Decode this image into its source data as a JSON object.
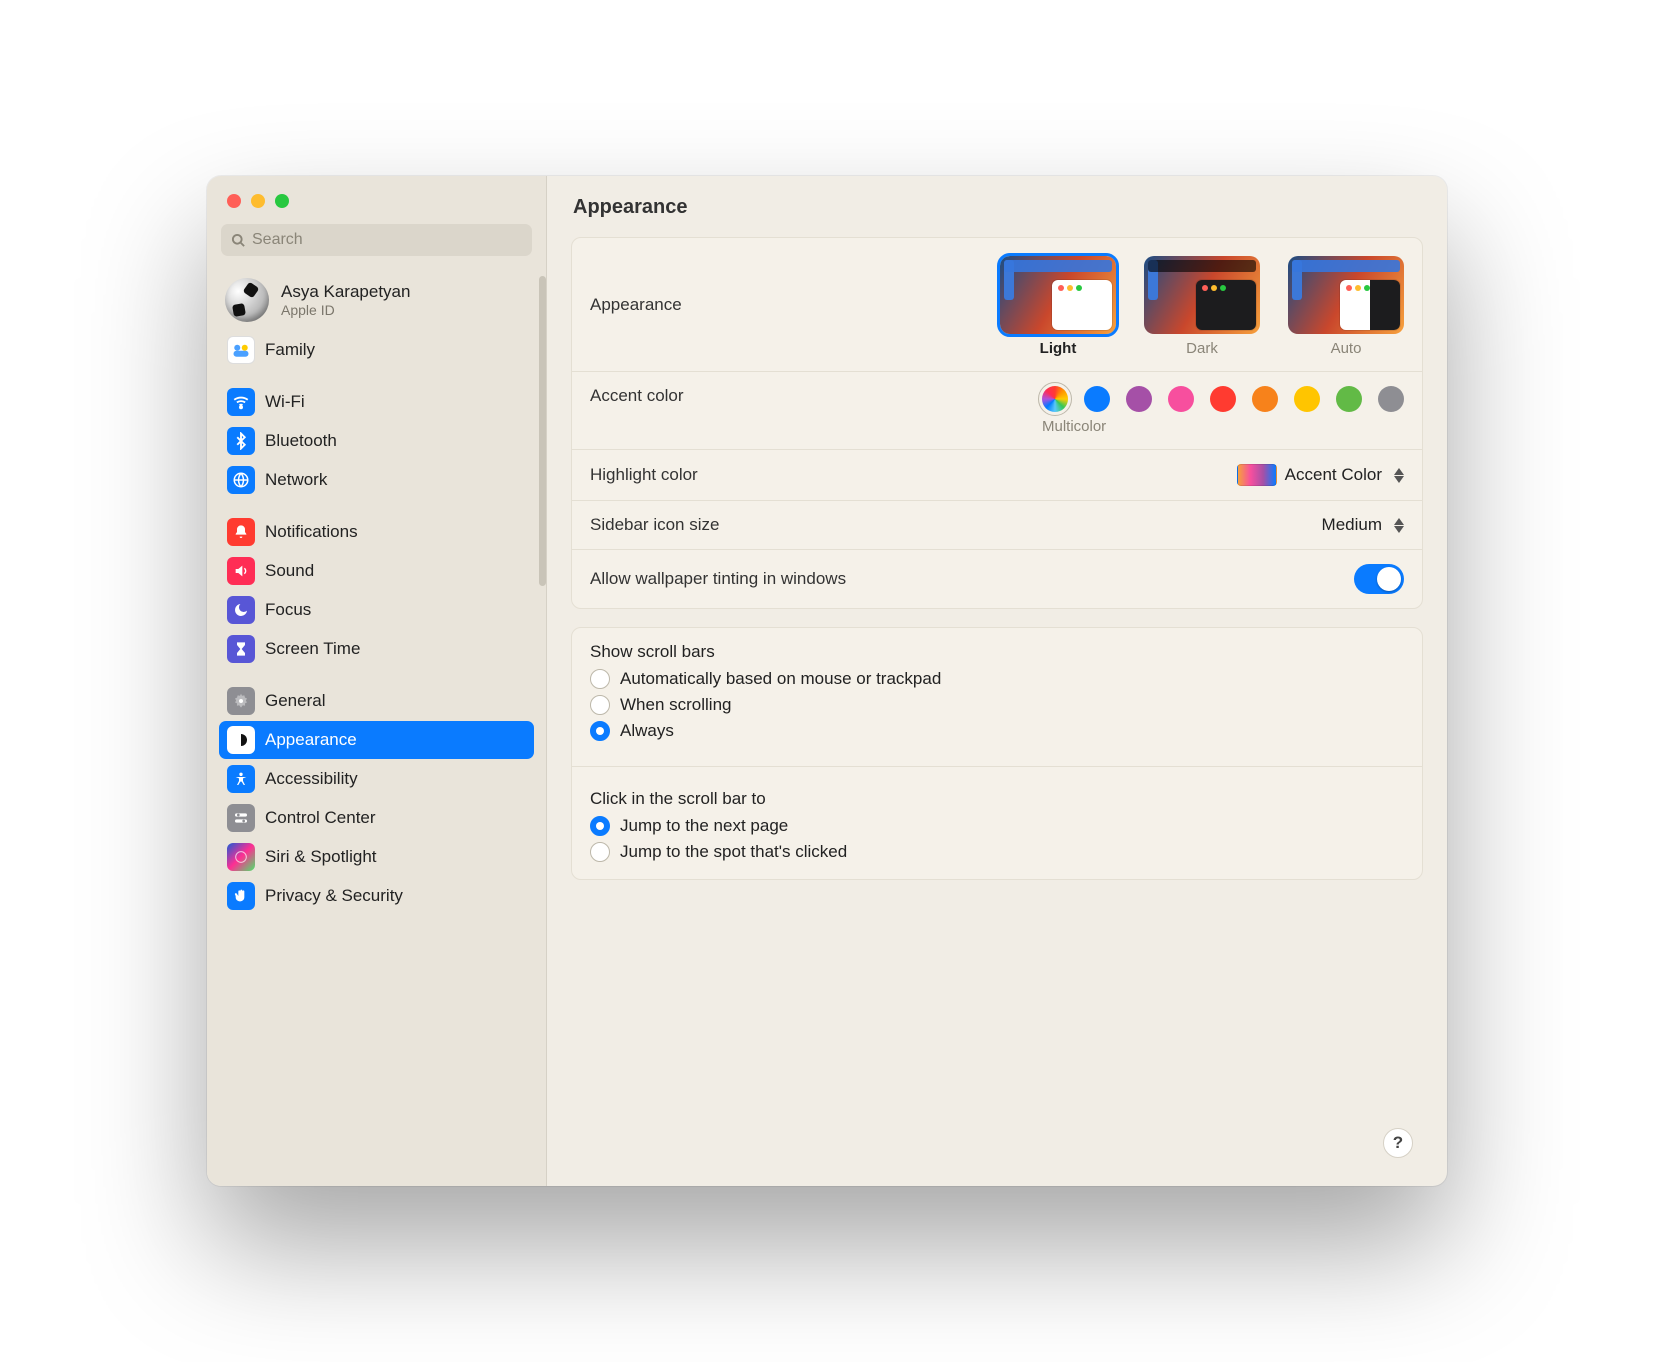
{
  "window": {
    "title": "Appearance"
  },
  "search": {
    "placeholder": "Search"
  },
  "user": {
    "name": "Asya Karapetyan",
    "sub": "Apple ID"
  },
  "sidebar": {
    "family": "Family",
    "items": [
      {
        "label": "Wi-Fi"
      },
      {
        "label": "Bluetooth"
      },
      {
        "label": "Network"
      },
      {
        "label": "Notifications"
      },
      {
        "label": "Sound"
      },
      {
        "label": "Focus"
      },
      {
        "label": "Screen Time"
      },
      {
        "label": "General"
      },
      {
        "label": "Appearance"
      },
      {
        "label": "Accessibility"
      },
      {
        "label": "Control Center"
      },
      {
        "label": "Siri & Spotlight"
      },
      {
        "label": "Privacy & Security"
      }
    ]
  },
  "appearance": {
    "section_label": "Appearance",
    "options": {
      "light": "Light",
      "dark": "Dark",
      "auto": "Auto"
    },
    "selected": "Light"
  },
  "accent": {
    "label": "Accent color",
    "selected_label": "Multicolor",
    "colors": [
      "multicolor",
      "blue",
      "purple",
      "pink",
      "red",
      "orange",
      "yellow",
      "green",
      "graphite"
    ]
  },
  "highlight": {
    "label": "Highlight color",
    "value": "Accent Color"
  },
  "sidebar_icon": {
    "label": "Sidebar icon size",
    "value": "Medium"
  },
  "tinting": {
    "label": "Allow wallpaper tinting in windows",
    "value": true
  },
  "scrollbars": {
    "label": "Show scroll bars",
    "options": [
      "Automatically based on mouse or trackpad",
      "When scrolling",
      "Always"
    ],
    "selected_index": 2
  },
  "click_scroll": {
    "label": "Click in the scroll bar to",
    "options": [
      "Jump to the next page",
      "Jump to the spot that's clicked"
    ],
    "selected_index": 0
  },
  "help": "?"
}
